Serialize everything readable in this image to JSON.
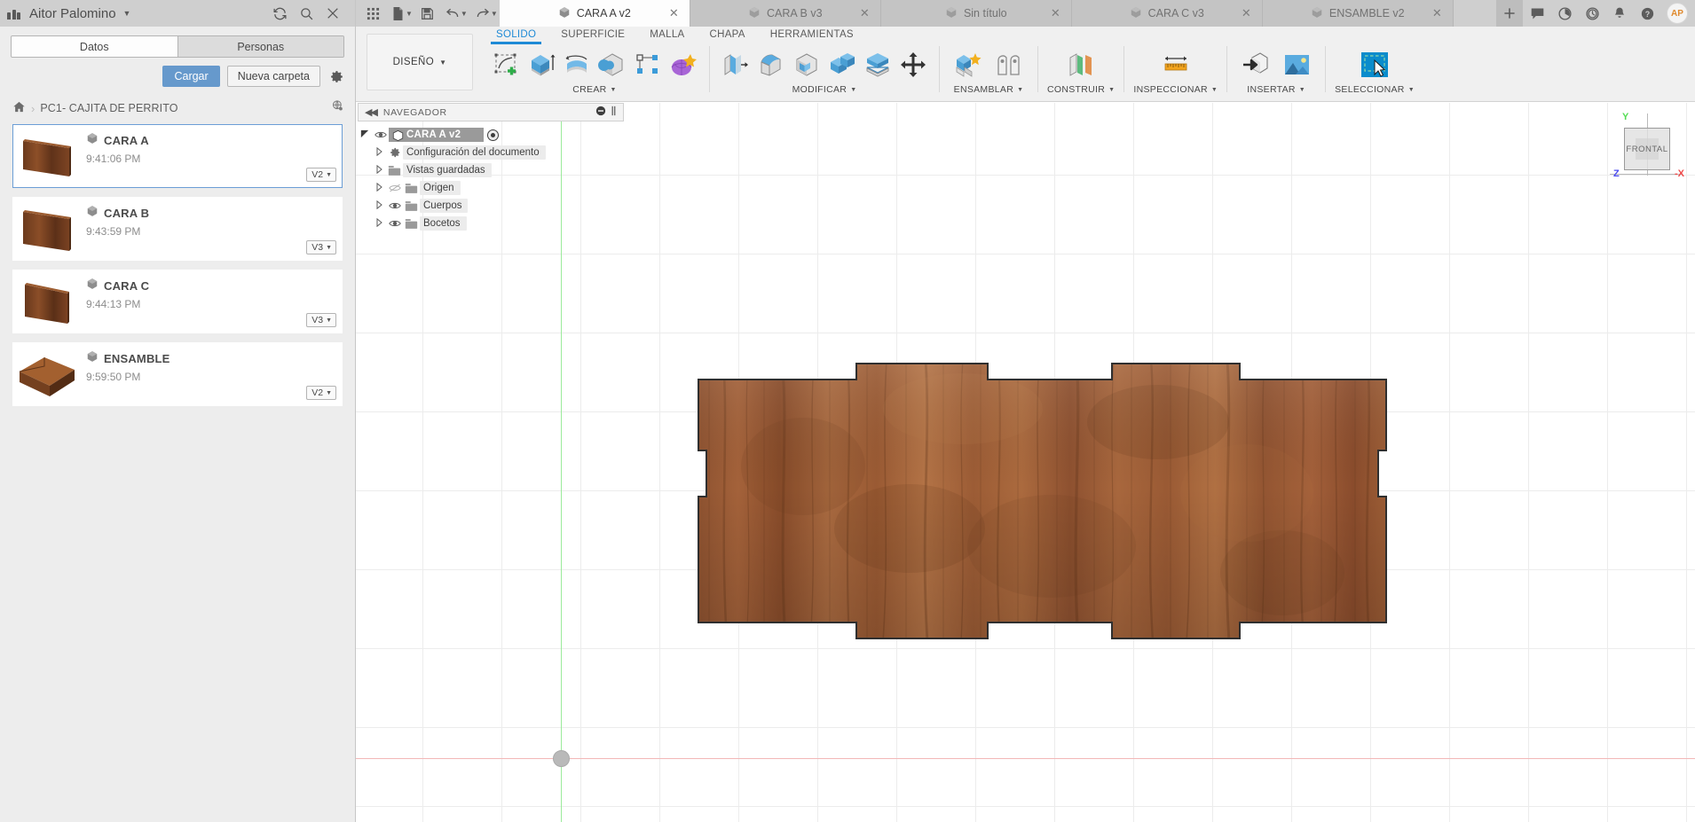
{
  "data_panel": {
    "user_name": "Aitor Palomino",
    "header_icons": [
      "refresh-icon",
      "search-icon",
      "close-icon"
    ],
    "tabs": [
      {
        "label": "Datos",
        "active": true
      },
      {
        "label": "Personas",
        "active": false
      }
    ],
    "actions": {
      "upload_label": "Cargar",
      "new_folder_label": "Nueva carpeta",
      "settings_icon": "gear-icon"
    },
    "breadcrumb": {
      "home_icon": "home-icon",
      "separator": "›",
      "path": "PC1- CAJITA DE PERRITO",
      "globe_icon": "globe-icon"
    },
    "files": [
      {
        "name": "CARA A",
        "time": "9:41:06 PM",
        "version": "V2",
        "selected": true,
        "thumb": "plank-thin"
      },
      {
        "name": "CARA B",
        "time": "9:43:59 PM",
        "version": "V3",
        "selected": false,
        "thumb": "plank-thin"
      },
      {
        "name": "CARA C",
        "time": "9:44:13 PM",
        "version": "V3",
        "selected": false,
        "thumb": "plank-thin"
      },
      {
        "name": "ENSAMBLE",
        "time": "9:59:50 PM",
        "version": "V2",
        "selected": false,
        "thumb": "box"
      }
    ]
  },
  "tabbar": {
    "quick_access": [
      "grid-apps-icon",
      "new-document-icon",
      "save-icon",
      "undo-icon",
      "redo-icon"
    ],
    "documents": [
      {
        "label": "CARA A v2",
        "active": true
      },
      {
        "label": "CARA B v3",
        "active": false
      },
      {
        "label": "Sin título",
        "active": false
      },
      {
        "label": "CARA C v3",
        "active": false
      },
      {
        "label": "ENSAMBLE v2",
        "active": false
      }
    ],
    "close_glyph": "✕",
    "right_icons": [
      "plus-icon",
      "comment-icon",
      "job-status-icon",
      "recent-icon",
      "bell-icon",
      "help-icon"
    ],
    "avatar_initials": "AP"
  },
  "ribbon": {
    "workspace_label": "DISEÑO",
    "tabs": [
      {
        "label": "SOLIDO",
        "active": true
      },
      {
        "label": "SUPERFICIE",
        "active": false
      },
      {
        "label": "MALLA",
        "active": false
      },
      {
        "label": "CHAPA",
        "active": false
      },
      {
        "label": "HERRAMIENTAS",
        "active": false
      }
    ],
    "groups": [
      {
        "label": "CREAR",
        "has_caret": true,
        "items": [
          "create-sketch-icon",
          "extrude-icon",
          "revolve-icon",
          "sweep-icon",
          "pattern-icon",
          "form-icon"
        ]
      },
      {
        "label": "MODIFICAR",
        "has_caret": true,
        "items": [
          "press-pull-icon",
          "fillet-icon",
          "shell-icon",
          "combine-icon",
          "split-body-icon",
          "move-copy-icon"
        ]
      },
      {
        "label": "ENSAMBLAR",
        "has_caret": true,
        "items": [
          "new-component-icon",
          "joint-icon"
        ]
      },
      {
        "label": "CONSTRUIR",
        "has_caret": true,
        "items": [
          "offset-plane-icon"
        ]
      },
      {
        "label": "INSPECCIONAR",
        "has_caret": true,
        "items": [
          "measure-icon"
        ]
      },
      {
        "label": "INSERTAR",
        "has_caret": true,
        "items": [
          "insert-derive-icon",
          "insert-canvas-icon"
        ]
      },
      {
        "label": "SELECCIONAR",
        "has_caret": true,
        "items": [
          "selection-filter-icon"
        ]
      }
    ]
  },
  "navigator": {
    "title": "NAVEGADOR",
    "collapse_glyph": "◀◀",
    "header_icons": [
      "minus-circle-icon",
      "pin-icon"
    ],
    "root": {
      "label": "CARA A v2",
      "visible": true,
      "component_icon": "component-icon",
      "radio_icon": "active-component-icon"
    },
    "items": [
      {
        "label": "Configuración del documento",
        "icon": "gear-icon",
        "has_eye": false,
        "visible": true
      },
      {
        "label": "Vistas guardadas",
        "icon": "folder-icon",
        "has_eye": false,
        "visible": true
      },
      {
        "label": "Origen",
        "icon": "folder-icon",
        "has_eye": true,
        "visible": false
      },
      {
        "label": "Cuerpos",
        "icon": "folder-icon",
        "has_eye": true,
        "visible": true
      },
      {
        "label": "Bocetos",
        "icon": "folder-icon",
        "has_eye": true,
        "visible": true
      }
    ]
  },
  "canvas": {
    "view_cube": {
      "face_label": "FRONTAL",
      "axis_y": "Y",
      "axis_x": "-X",
      "axis_z": "Z"
    },
    "origin_marker_icon": "origin-point-icon",
    "model_name": "wooden-plank-with-finger-joints"
  },
  "colors": {
    "accent_blue": "#1e8ad6",
    "upload_button": "#6699cc",
    "panel_bg": "#ededed",
    "tabbar_bg": "#cfcfcf",
    "ribbon_bg": "#f0f0f0",
    "selection_border": "#6b9ed6",
    "axis_x": "#f3b7b7",
    "axis_y": "#9bea9b",
    "grid_line": "#ececec",
    "wood_light": "#b3703f",
    "wood_mid": "#9b5a30",
    "wood_dark": "#6d3b1e"
  }
}
